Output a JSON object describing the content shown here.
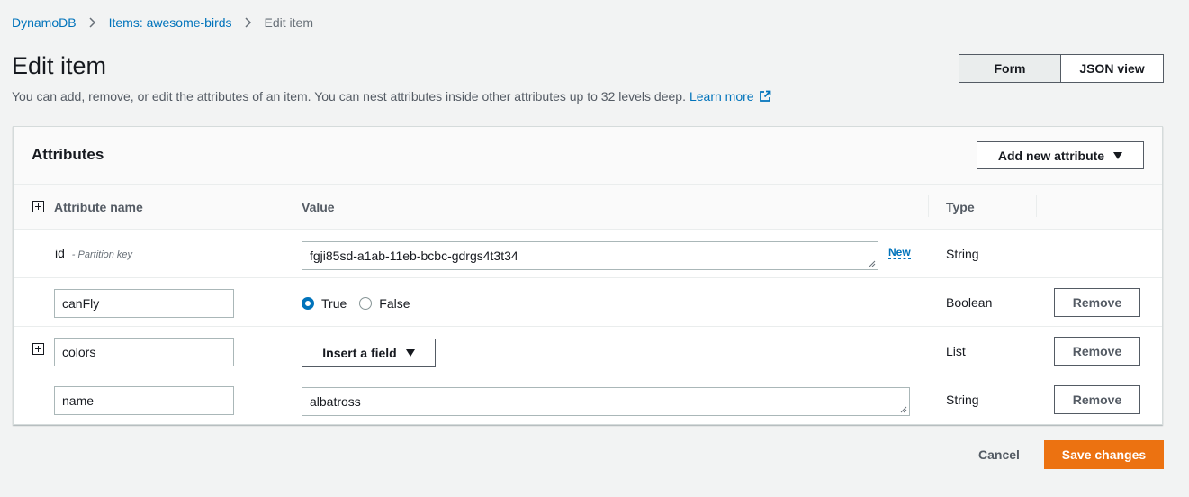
{
  "breadcrumb": {
    "items": [
      "DynamoDB",
      "Items: awesome-birds"
    ],
    "current": "Edit item"
  },
  "page": {
    "title": "Edit item",
    "description": "You can add, remove, or edit the attributes of an item. You can nest attributes inside other attributes up to 32 levels deep.",
    "learn_more": "Learn more"
  },
  "view_toggle": {
    "form": "Form",
    "json": "JSON view",
    "selected": "Form"
  },
  "attributes": {
    "title": "Attributes",
    "add_button": "Add new attribute",
    "columns": {
      "name": "Attribute name",
      "value": "Value",
      "type": "Type"
    },
    "rows": [
      {
        "name": "id",
        "key_label": "- Partition key",
        "value": "fgji85sd-a1ab-11eb-bcbc-gdrgs4t3t34",
        "new_badge": "New",
        "type": "String"
      },
      {
        "name": "canFly",
        "options": [
          "True",
          "False"
        ],
        "selected": "True",
        "type": "Boolean",
        "remove": "Remove"
      },
      {
        "name": "colors",
        "value_button": "Insert a field",
        "type": "List",
        "remove": "Remove"
      },
      {
        "name": "name",
        "value": "albatross",
        "type": "String",
        "remove": "Remove"
      }
    ]
  },
  "footer": {
    "cancel": "Cancel",
    "save": "Save changes"
  },
  "colors": {
    "link": "#0073bb",
    "primary": "#ec7211",
    "background": "#f2f3f3"
  }
}
